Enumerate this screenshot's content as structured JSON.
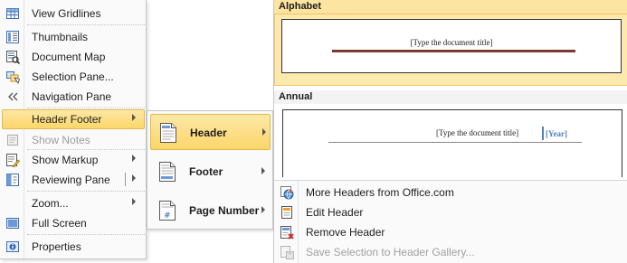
{
  "view_menu": {
    "items": [
      {
        "label": "View Gridlines",
        "icon": "gridlines-icon"
      },
      {
        "label": "Thumbnails",
        "icon": "thumbnails-icon"
      },
      {
        "label": "Document Map",
        "icon": "document-map-icon"
      },
      {
        "label": "Selection Pane...",
        "icon": "selection-pane-icon"
      },
      {
        "label": "Navigation Pane",
        "icon": "navigation-pane-icon"
      },
      {
        "label": "Header Footer",
        "icon": "none"
      },
      {
        "label": "Show Notes",
        "icon": "show-notes-icon"
      },
      {
        "label": "Show Markup",
        "icon": "show-markup-icon"
      },
      {
        "label": "Reviewing Pane",
        "icon": "reviewing-pane-icon"
      },
      {
        "label": "Zoom...",
        "icon": "none"
      },
      {
        "label": "Full Screen",
        "icon": "full-screen-icon"
      },
      {
        "label": "Properties",
        "icon": "properties-icon"
      }
    ]
  },
  "header_footer_menu": {
    "items": [
      {
        "label": "Header",
        "icon": "header-page-icon"
      },
      {
        "label": "Footer",
        "icon": "footer-page-icon"
      },
      {
        "label": "Page Number",
        "icon": "page-number-icon"
      }
    ]
  },
  "gallery": {
    "categories": [
      {
        "name": "Alphabet",
        "sample_title": "[Type the document title]"
      },
      {
        "name": "Annual",
        "sample_title": "[Type the document title]",
        "sample_year": "[Year]"
      }
    ],
    "commands": [
      {
        "label": "More Headers from Office.com",
        "icon": "office-globe-icon"
      },
      {
        "label": "Edit Header",
        "icon": "edit-header-icon"
      },
      {
        "label": "Remove Header",
        "icon": "remove-header-icon"
      },
      {
        "label": "Save Selection to Header Gallery...",
        "icon": "save-selection-icon"
      }
    ]
  },
  "colors": {
    "highlight": "#fbd66a",
    "alphabet_rule": "#7a3b2e",
    "annual_accent": "#4f81bd"
  }
}
